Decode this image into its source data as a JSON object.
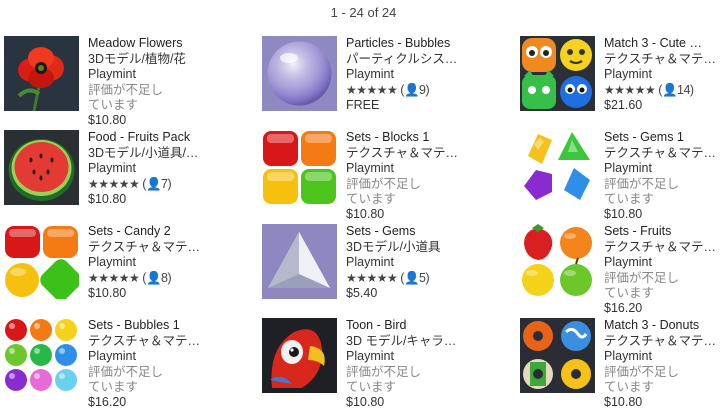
{
  "pager": "1 - 24 of 24",
  "items": [
    {
      "title": "Meadow Flowers",
      "category": "3Dモデル/植物/花",
      "publisher": "Playmint",
      "rating_text": "評価が不足しています",
      "price": "$10.80",
      "icon": "poppy-flower-icon"
    },
    {
      "title": "Particles - Bubbles",
      "category": "パーティクルシス…",
      "publisher": "Playmint",
      "stars": "★★★★★",
      "count": "(👤9)",
      "price": "FREE",
      "icon": "bubble-icon"
    },
    {
      "title": "Match 3 - Cute …",
      "category": "テクスチャ＆マテ…",
      "publisher": "Playmint",
      "stars": "★★★★★",
      "count": "(👤14)",
      "price": "$21.60",
      "icon": "cute-creatures-icon"
    },
    {
      "title": "Food - Fruits Pack",
      "category": "3Dモデル/小道具/…",
      "publisher": "Playmint",
      "stars": "★★★★★",
      "count": "(👤7)",
      "price": "$10.80",
      "icon": "watermelon-icon"
    },
    {
      "title": "Sets - Blocks 1",
      "category": "テクスチャ＆マテ…",
      "publisher": "Playmint",
      "rating_text": "評価が不足しています",
      "price": "$10.80",
      "icon": "color-blocks-icon"
    },
    {
      "title": "Sets - Gems 1",
      "category": "テクスチャ＆マテ…",
      "publisher": "Playmint",
      "rating_text": "評価が不足しています",
      "price": "$10.80",
      "icon": "gems-icon"
    },
    {
      "title": "Sets - Candy 2",
      "category": "テクスチャ＆マテ…",
      "publisher": "Playmint",
      "stars": "★★★★★",
      "count": "(👤8)",
      "price": "$10.80",
      "icon": "candy-icon"
    },
    {
      "title": "Sets - Gems",
      "category": "3Dモデル/小道具",
      "publisher": "Playmint",
      "stars": "★★★★★",
      "count": "(👤5)",
      "price": "$5.40",
      "icon": "triangle-gem-icon"
    },
    {
      "title": "Sets - Fruits",
      "category": "テクスチャ＆マテ…",
      "publisher": "Playmint",
      "rating_text": "評価が不足しています",
      "price": "$16.20",
      "icon": "fruits-icon"
    },
    {
      "title": "Sets - Bubbles 1",
      "category": "テクスチャ＆マテ…",
      "publisher": "Playmint",
      "rating_text": "評価が不足しています",
      "price": "$16.20",
      "icon": "color-bubbles-icon"
    },
    {
      "title": "Toon - Bird",
      "category": "3D モデル/キャラ…",
      "publisher": "Playmint",
      "rating_text": "評価が不足しています",
      "price": "$10.80",
      "icon": "parrot-icon"
    },
    {
      "title": "Match 3 - Donuts",
      "category": "テクスチャ＆マテ…",
      "publisher": "Playmint",
      "rating_text": "評価が不足しています",
      "price": "$10.80",
      "icon": "donuts-icon"
    }
  ]
}
